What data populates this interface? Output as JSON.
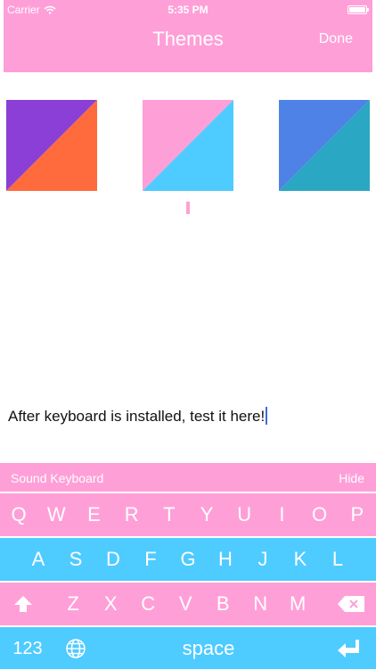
{
  "status_bar": {
    "carrier": "Carrier",
    "time": "5:35 PM",
    "battery_level": 1.0
  },
  "nav": {
    "title": "Themes",
    "done_label": "Done"
  },
  "themes": [
    {
      "colors": [
        "#8b3fd6",
        "#ff6b3d"
      ]
    },
    {
      "colors": [
        "#ff9fd8",
        "#4ecbff"
      ]
    },
    {
      "colors": [
        "#4f82e6",
        "#2aa7c2"
      ]
    }
  ],
  "selected_theme": 1,
  "test_area": {
    "text": "After keyboard is installed, test it here!"
  },
  "keyboard": {
    "title": "Sound Keyboard",
    "hide_label": "Hide",
    "row1": [
      "Q",
      "W",
      "E",
      "R",
      "T",
      "Y",
      "U",
      "I",
      "O",
      "P"
    ],
    "row2": [
      "A",
      "S",
      "D",
      "F",
      "G",
      "H",
      "J",
      "K",
      "L"
    ],
    "row3": [
      "Z",
      "X",
      "C",
      "V",
      "B",
      "N",
      "M"
    ],
    "numbers_label": "123",
    "space_label": "space"
  },
  "colors": {
    "accent_pink": "#ff9fd8",
    "accent_cyan": "#4ecbff",
    "caret": "#3d6be8"
  }
}
